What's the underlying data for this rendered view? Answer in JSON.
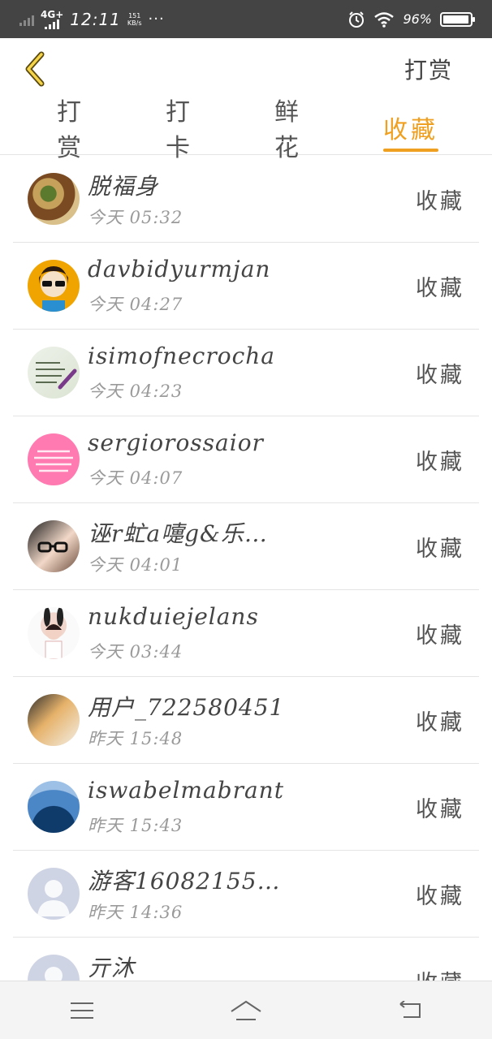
{
  "status_bar": {
    "network": "4G+",
    "time": "12:11",
    "speed_value": "151",
    "speed_unit": "KB/s",
    "more": "···",
    "battery_percent": "96%",
    "battery_level": 0.96
  },
  "header": {
    "action_label": "打赏"
  },
  "tabs": [
    {
      "label": "打赏",
      "active": false
    },
    {
      "label": "打卡",
      "active": false
    },
    {
      "label": "鲜花",
      "active": false
    },
    {
      "label": "收藏",
      "active": true
    }
  ],
  "items": [
    {
      "name": "脱福身",
      "time": "今天 05:32",
      "action": "收藏",
      "avatar": "photo-avatar"
    },
    {
      "name": "davbidyurmjan",
      "time": "今天 04:27",
      "action": "收藏",
      "avatar": "photo-avatar"
    },
    {
      "name": "isimofnecrocha",
      "time": "今天 04:23",
      "action": "收藏",
      "avatar": "photo-avatar"
    },
    {
      "name": "sergiorossaior",
      "time": "今天 04:07",
      "action": "收藏",
      "avatar": "photo-avatar"
    },
    {
      "name": "诬r虻a嚏g&乐…",
      "time": "今天 04:01",
      "action": "收藏",
      "avatar": "photo-avatar"
    },
    {
      "name": "nukduiejelans",
      "time": "今天 03:44",
      "action": "收藏",
      "avatar": "photo-avatar"
    },
    {
      "name": "用户_722580451",
      "time": "昨天 15:48",
      "action": "收藏",
      "avatar": "photo-avatar"
    },
    {
      "name": "iswabelmabrant",
      "time": "昨天 15:43",
      "action": "收藏",
      "avatar": "photo-avatar"
    },
    {
      "name": "游客16082155…",
      "time": "昨天 14:36",
      "action": "收藏",
      "avatar": "default-user-icon"
    },
    {
      "name": "亓沐",
      "time": "",
      "action": "收藏",
      "avatar": "default-user-icon"
    }
  ],
  "colors": {
    "accent": "#f0a020",
    "status_bar_bg": "#444444"
  }
}
